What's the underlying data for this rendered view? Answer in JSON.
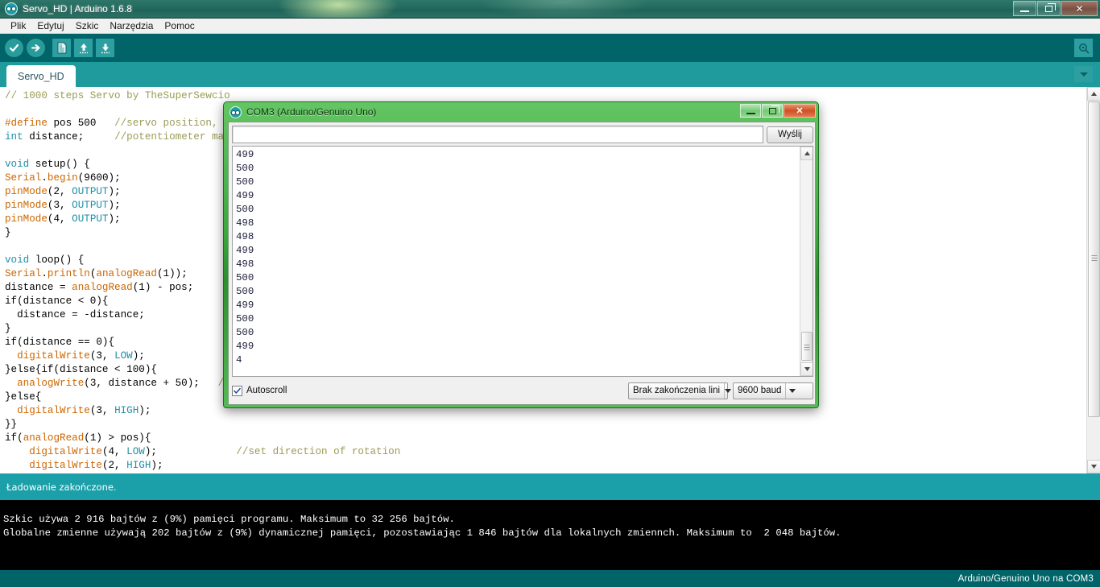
{
  "window": {
    "title": "Servo_HD | Arduino 1.6.8",
    "icon": "arduino-logo-icon",
    "minimize_label": "–",
    "restore_label": "❐",
    "close_label": "✕"
  },
  "menubar": {
    "items": [
      {
        "label": "Plik",
        "name": "menu-plik"
      },
      {
        "label": "Edytuj",
        "name": "menu-edytuj"
      },
      {
        "label": "Szkic",
        "name": "menu-szkic"
      },
      {
        "label": "Narzędzia",
        "name": "menu-narzedzia"
      },
      {
        "label": "Pomoc",
        "name": "menu-pomoc"
      }
    ]
  },
  "toolbar": {
    "verify": "verify-icon",
    "upload": "upload-icon",
    "new": "new-sketch-icon",
    "open": "open-sketch-icon",
    "save": "save-sketch-icon",
    "serial_monitor": "serial-monitor-icon"
  },
  "tabs": {
    "active": "Servo_HD",
    "dropdown": "chevron-down-icon"
  },
  "editor": {
    "code_lines": [
      "// 1000 steps Servo by TheSuperSewcio",
      "",
      "#define pos 500   //servo position, us",
      "int distance;     //potentiometer may ",
      "",
      "void setup() {",
      "Serial.begin(9600);",
      "pinMode(2, OUTPUT);",
      "pinMode(3, OUTPUT);",
      "pinMode(4, OUTPUT);",
      "}",
      "",
      "void loop() {",
      "Serial.println(analogRead(1));",
      "distance = analogRead(1) - pos;",
      "if(distance < 0){",
      "  distance = -distance;",
      "}",
      "if(distance == 0){",
      "  digitalWrite(3, LOW);",
      "}else{if(distance < 100){              //r",
      "  analogWrite(3, distance + 50);   //m",
      "}else{",
      "  digitalWrite(3, HIGH);",
      "}}",
      "if(analogRead(1) > pos){",
      "    digitalWrite(4, LOW);             //set direction of rotation",
      "    digitalWrite(2, HIGH);"
    ]
  },
  "serial_monitor": {
    "title": "COM3 (Arduino/Genuino Uno)",
    "icon": "arduino-logo-icon",
    "minimize_label": "–",
    "restore_label": "❐",
    "close_label": "✕",
    "input_value": "",
    "input_placeholder": "",
    "send_button": "Wyślij",
    "output_lines": [
      "499",
      "500",
      "500",
      "499",
      "500",
      "498",
      "498",
      "499",
      "498",
      "500",
      "500",
      "499",
      "500",
      "500",
      "499",
      "4"
    ],
    "autoscroll_label": "Autoscroll",
    "autoscroll_checked": true,
    "line_ending": "Brak zakończenia lini",
    "baud_rate": "9600 baud"
  },
  "status": {
    "message": "Ładowanie zakończone."
  },
  "console": {
    "lines": [
      "Szkic używa 2 916 bajtów z (9%) pamięci programu. Maksimum to 32 256 bajtów.",
      "Globalne zmienne używają 202 bajtów z (9%) dynamicznej pamięci, pozostawiając 1 846 bajtów dla lokalnych zmiennch. Maksimum to  2 048 bajtów."
    ]
  },
  "bottom_bar": {
    "board_info": "Arduino/Genuino Uno na COM3"
  },
  "colors": {
    "toolbar_bg": "#006468",
    "tabstrip_bg": "#1f9b9e",
    "status_bg": "#1b9fa8",
    "console_bg": "#000000",
    "dialog_frame": "#3da93d",
    "comment": "#9b9b57",
    "keyword": "#cc6600",
    "type": "#1f8fa8"
  }
}
